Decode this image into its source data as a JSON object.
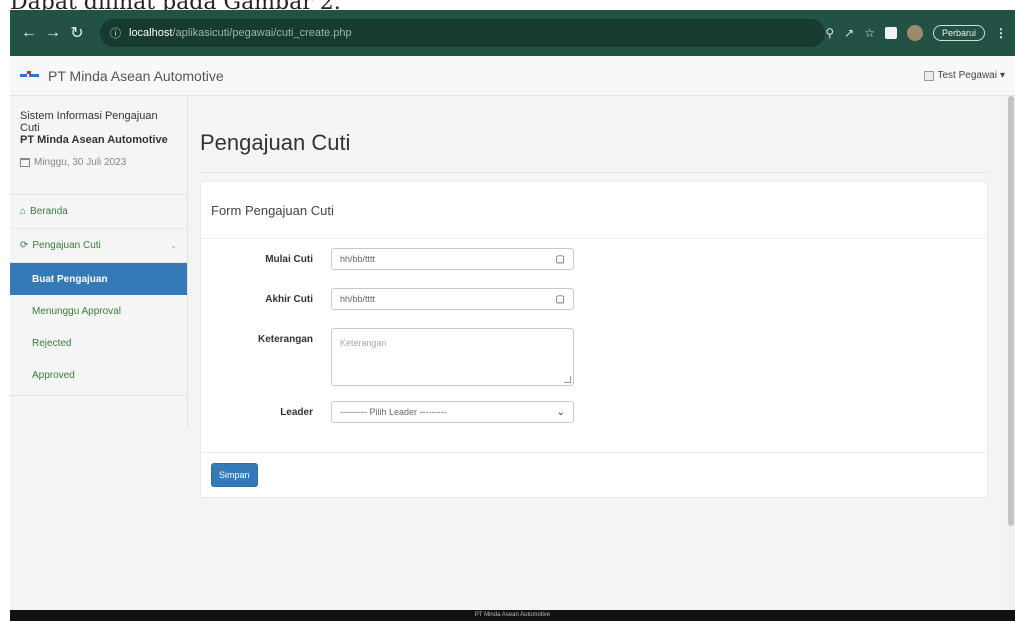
{
  "document": {
    "caption": "Dapat dilihat pada Gambar 2."
  },
  "browser": {
    "url_host": "localhost",
    "url_path": "/aplikasicuti/pegawai/cuti_create.php",
    "update_label": "Perbarui",
    "frame_color": "#225245"
  },
  "navbar": {
    "brand": "PT Minda Asean Automotive",
    "user_label": "Test Pegawai"
  },
  "sidebar": {
    "title": "Sistem Informasi Pengajuan Cuti",
    "company": "PT Minda Asean Automotive",
    "date": "Minggu, 30 Juli 2023",
    "items": [
      {
        "label": "Beranda",
        "icon": "home-icon"
      },
      {
        "label": "Pengajuan Cuti",
        "icon": "refresh-icon"
      }
    ],
    "subitems": [
      {
        "label": "Buat Pengajuan",
        "active": true
      },
      {
        "label": "Menunggu Approval"
      },
      {
        "label": "Rejected"
      },
      {
        "label": "Approved"
      }
    ],
    "active_color": "#337ab7"
  },
  "main": {
    "page_title": "Pengajuan Cuti",
    "panel_title": "Form Pengajuan Cuti",
    "fields": {
      "mulai": {
        "label": "Mulai Cuti",
        "placeholder": "hh/bb/tttt"
      },
      "akhir": {
        "label": "Akhir Cuti",
        "placeholder": "hh/bb/tttt"
      },
      "keterangan": {
        "label": "Keterangan",
        "placeholder": "Keterangan"
      },
      "leader": {
        "label": "Leader",
        "selected": "--------- Pilih Leader ---------"
      }
    },
    "save_label": "Simpan"
  },
  "footer": {
    "text": "PT Minda Asean Automotive"
  }
}
